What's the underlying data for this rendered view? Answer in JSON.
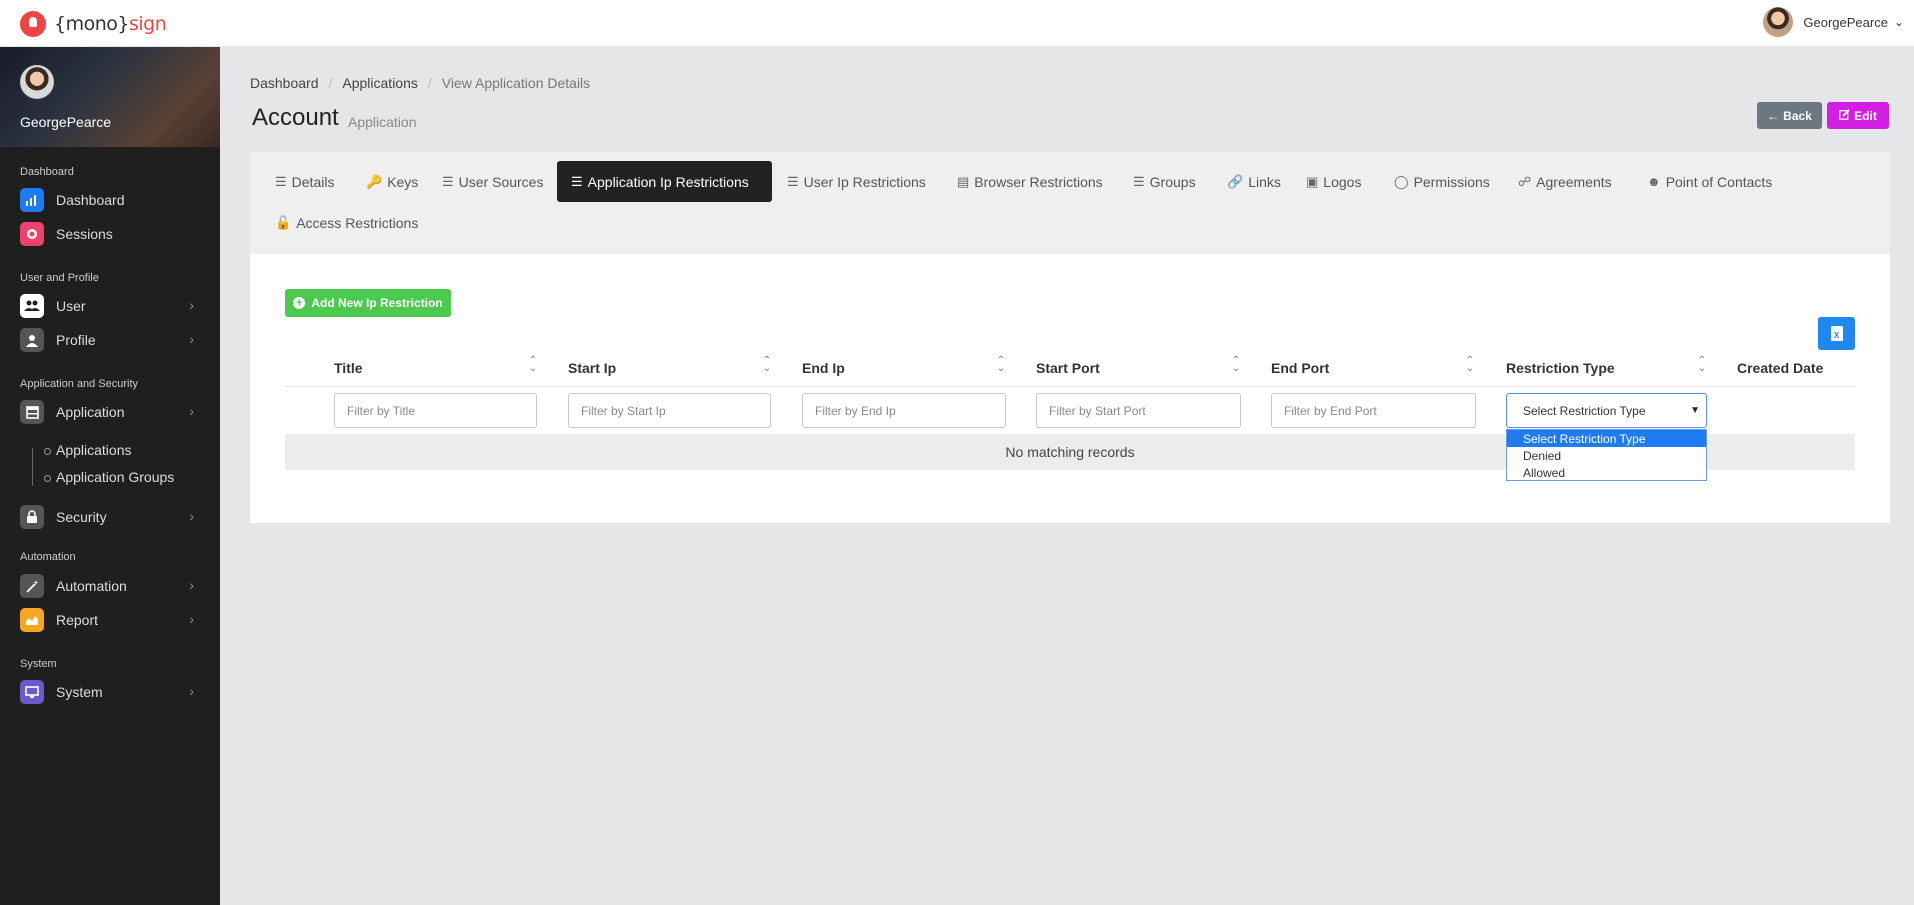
{
  "app": {
    "logo_main": "{mono}",
    "logo_accent": "sign"
  },
  "topbar": {
    "username": "GeorgePearce"
  },
  "sidebar": {
    "username": "GeorgePearce",
    "sections": {
      "dashboard": "Dashboard",
      "user_profile": "User and Profile",
      "app_security": "Application and Security",
      "automation": "Automation",
      "system": "System"
    },
    "items": {
      "dashboard": "Dashboard",
      "sessions": "Sessions",
      "user": "User",
      "profile": "Profile",
      "application": "Application",
      "applications": "Applications",
      "application_groups": "Application Groups",
      "security": "Security",
      "automation": "Automation",
      "report": "Report",
      "system": "System"
    },
    "colors": {
      "dashboard": "#1e7cf2",
      "sessions": "#f0416c",
      "user": "#ffffff",
      "profile": "#555555",
      "application": "#555555",
      "security": "#555555",
      "automation": "#555555",
      "report": "#f5a623",
      "system": "#6a5acd"
    }
  },
  "breadcrumb": {
    "item1": "Dashboard",
    "item2": "Applications",
    "current": "View Application Details"
  },
  "header": {
    "title": "Account",
    "subtitle": "Application",
    "back_label": "Back",
    "edit_label": "Edit"
  },
  "tabs": {
    "details": "Details",
    "keys": "Keys",
    "user_sources": "User Sources",
    "app_ip_restrictions": "Application Ip Restrictions",
    "user_ip_restrictions": "User Ip Restrictions",
    "browser_restrictions": "Browser Restrictions",
    "groups": "Groups",
    "links": "Links",
    "logos": "Logos",
    "permissions": "Permissions",
    "agreements": "Agreements",
    "point_of_contacts": "Point of Contacts",
    "access_restrictions": "Access Restrictions"
  },
  "content": {
    "add_button": "Add New Ip Restriction",
    "columns": {
      "title": "Title",
      "start_ip": "Start Ip",
      "end_ip": "End Ip",
      "start_port": "Start Port",
      "end_port": "End Port",
      "restriction_type": "Restriction Type",
      "created_date": "Created Date"
    },
    "filters": {
      "title": "Filter by Title",
      "start_ip": "Filter by Start Ip",
      "end_ip": "Filter by End Ip",
      "start_port": "Filter by Start Port",
      "end_port": "Filter by End Port"
    },
    "select_value": "Select Restriction Type",
    "select_options": [
      "Select Restriction Type",
      "Denied",
      "Allowed"
    ],
    "empty_message": "No matching records"
  }
}
